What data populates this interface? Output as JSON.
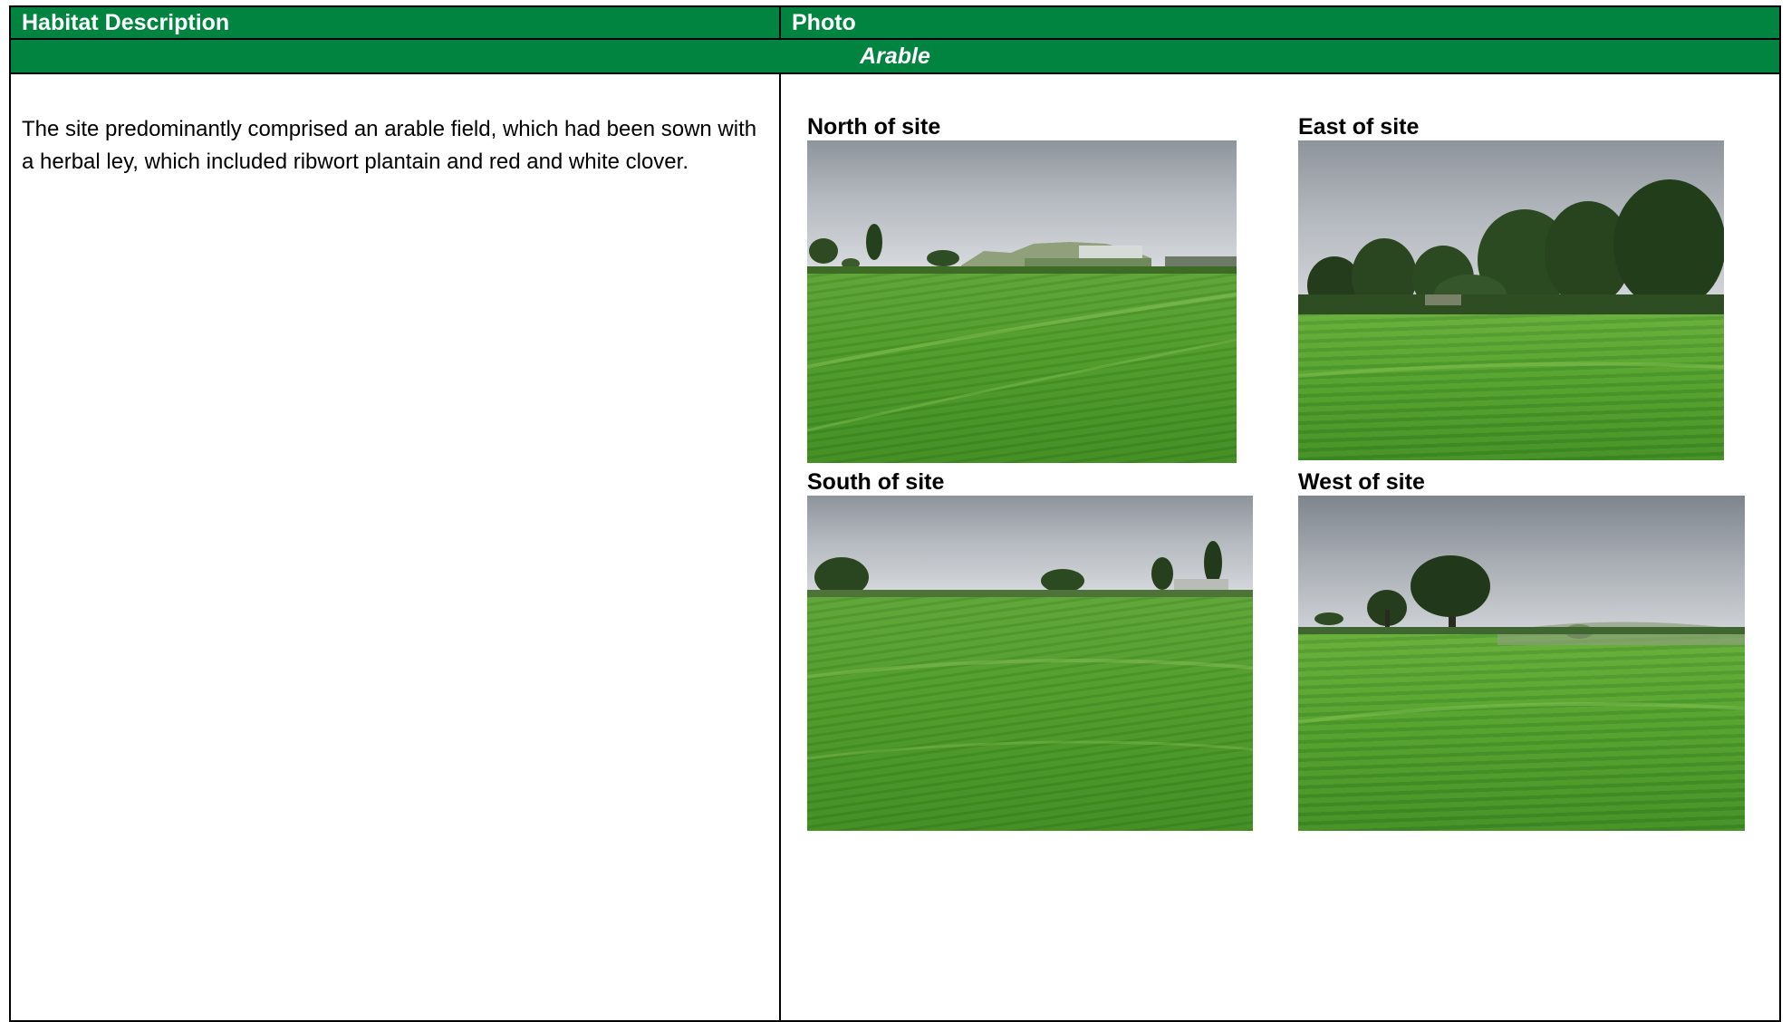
{
  "table": {
    "header": {
      "habitat_description": "Habitat Description",
      "photo": "Photo"
    },
    "section_title": "Arable",
    "description": "The site predominantly comprised an arable field, which had been sown with a herbal ley, which included ribwort plantain and red and white clover.",
    "photos": [
      {
        "label": "North of site",
        "subject": "photo of field with farm buildings on horizon"
      },
      {
        "label": "East of site",
        "subject": "photo of field with tree line"
      },
      {
        "label": "South of site",
        "subject": "photo of field with scattered trees"
      },
      {
        "label": "West of site",
        "subject": "photo of field with large oak tree"
      }
    ]
  },
  "colors": {
    "header_green": "#00843f",
    "header_text": "#ffffff",
    "border": "#000000"
  }
}
